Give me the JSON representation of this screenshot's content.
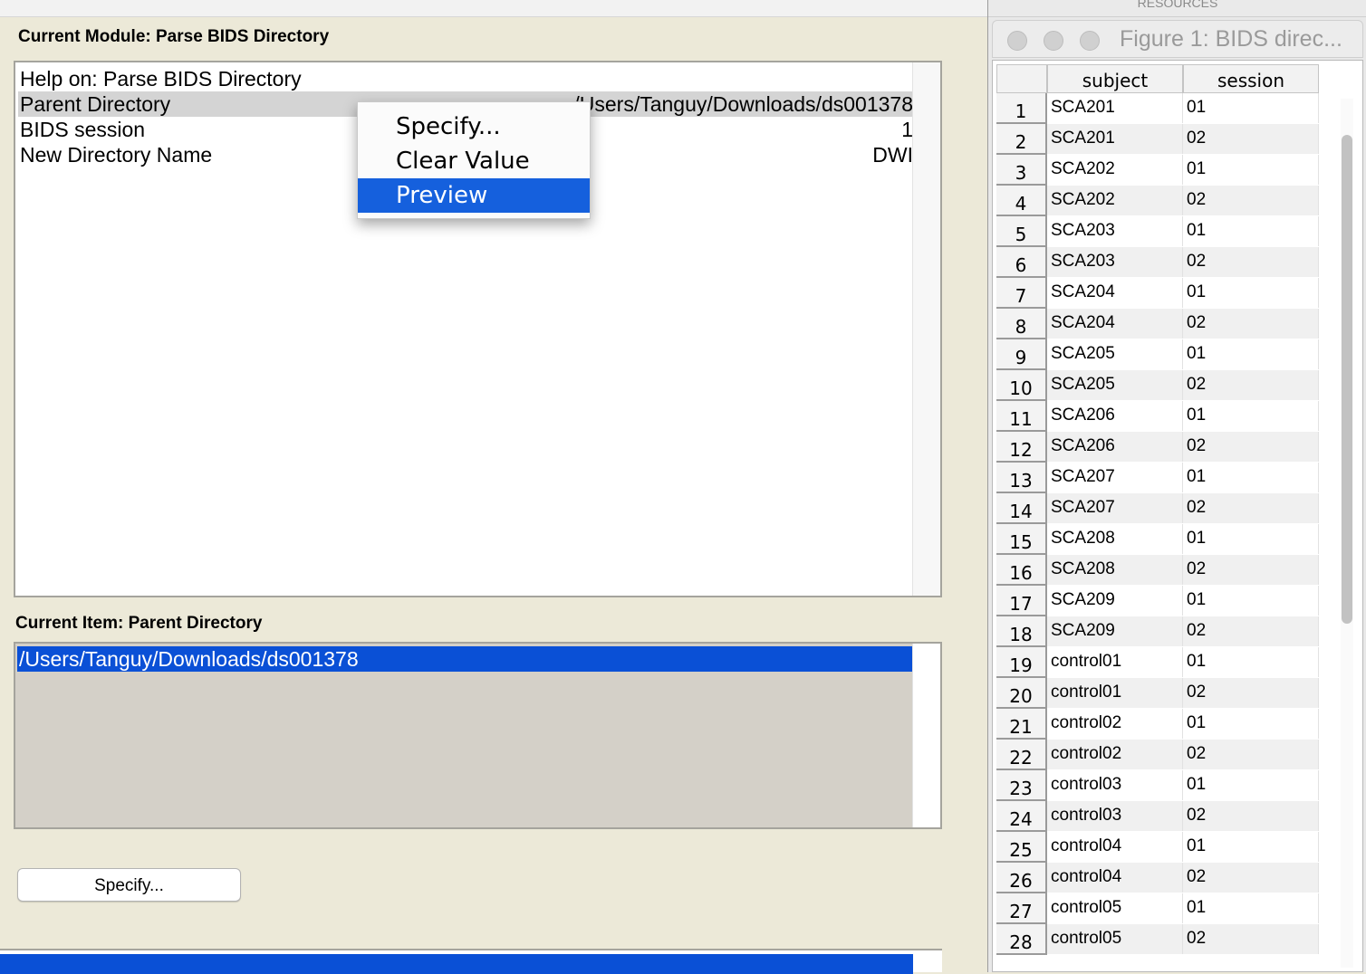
{
  "left_panel": {
    "module_title": "Current Module: Parse BIDS Directory",
    "items": [
      {
        "label": "Help on: Parse BIDS Directory",
        "value": ""
      },
      {
        "label": "Parent Directory",
        "value": "/Users/Tanguy/Downloads/ds001378"
      },
      {
        "label": "BIDS session",
        "value": "1"
      },
      {
        "label": "New Directory Name",
        "value": "DWI"
      }
    ],
    "context_menu": {
      "items": [
        "Specify...",
        "Clear Value",
        "Preview"
      ],
      "highlighted": "Preview"
    },
    "current_item_title": "Current Item: Parent Directory",
    "current_value": "/Users/Tanguy/Downloads/ds001378",
    "specify_button": "Specify..."
  },
  "figure": {
    "top_strip_text": "RESOURCES",
    "title": "Figure 1: BIDS direc...",
    "columns": [
      "subject",
      "session"
    ],
    "rows": [
      {
        "n": "1",
        "subject": "SCA201",
        "session": "01"
      },
      {
        "n": "2",
        "subject": "SCA201",
        "session": "02"
      },
      {
        "n": "3",
        "subject": "SCA202",
        "session": "01"
      },
      {
        "n": "4",
        "subject": "SCA202",
        "session": "02"
      },
      {
        "n": "5",
        "subject": "SCA203",
        "session": "01"
      },
      {
        "n": "6",
        "subject": "SCA203",
        "session": "02"
      },
      {
        "n": "7",
        "subject": "SCA204",
        "session": "01"
      },
      {
        "n": "8",
        "subject": "SCA204",
        "session": "02"
      },
      {
        "n": "9",
        "subject": "SCA205",
        "session": "01"
      },
      {
        "n": "10",
        "subject": "SCA205",
        "session": "02"
      },
      {
        "n": "11",
        "subject": "SCA206",
        "session": "01"
      },
      {
        "n": "12",
        "subject": "SCA206",
        "session": "02"
      },
      {
        "n": "13",
        "subject": "SCA207",
        "session": "01"
      },
      {
        "n": "14",
        "subject": "SCA207",
        "session": "02"
      },
      {
        "n": "15",
        "subject": "SCA208",
        "session": "01"
      },
      {
        "n": "16",
        "subject": "SCA208",
        "session": "02"
      },
      {
        "n": "17",
        "subject": "SCA209",
        "session": "01"
      },
      {
        "n": "18",
        "subject": "SCA209",
        "session": "02"
      },
      {
        "n": "19",
        "subject": "control01",
        "session": "01"
      },
      {
        "n": "20",
        "subject": "control01",
        "session": "02"
      },
      {
        "n": "21",
        "subject": "control02",
        "session": "01"
      },
      {
        "n": "22",
        "subject": "control02",
        "session": "02"
      },
      {
        "n": "23",
        "subject": "control03",
        "session": "01"
      },
      {
        "n": "24",
        "subject": "control03",
        "session": "02"
      },
      {
        "n": "25",
        "subject": "control04",
        "session": "01"
      },
      {
        "n": "26",
        "subject": "control04",
        "session": "02"
      },
      {
        "n": "27",
        "subject": "control05",
        "session": "01"
      },
      {
        "n": "28",
        "subject": "control05",
        "session": "02"
      }
    ]
  }
}
